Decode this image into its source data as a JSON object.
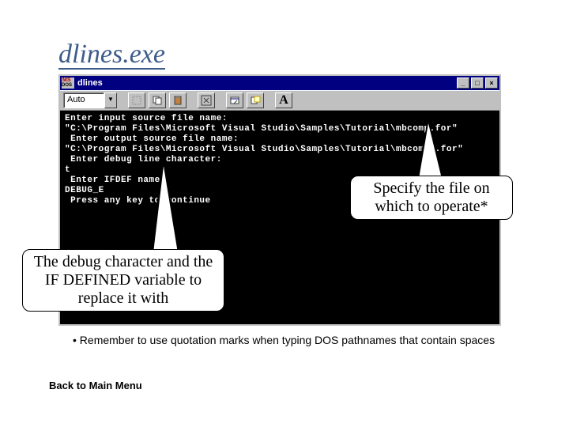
{
  "title": "dlines.exe",
  "window": {
    "title": "dlines",
    "combo_value": "Auto",
    "controls": {
      "min": "_",
      "max": "□",
      "close": "×"
    }
  },
  "console": {
    "lines": [
      "Enter input source file name:",
      "\"C:\\Program Files\\Microsoft Visual Studio\\Samples\\Tutorial\\mbcomp.for\"",
      " Enter output source file name:",
      "\"C:\\Program Files\\Microsoft Visual Studio\\Samples\\Tutorial\\mbcomp2.for\"",
      " Enter debug line character:",
      "t",
      " Enter IFDEF name:",
      "DEBUG_E",
      " Press any key to continue"
    ]
  },
  "callouts": {
    "right": "Specify the file on which to operate*",
    "left": "The debug character and the IF DEFINED variable to replace it with"
  },
  "note": "Remember to use quotation marks when typing DOS pathnames that contain spaces",
  "back": "Back to Main Menu",
  "toolbar": {
    "font_button": "A"
  }
}
